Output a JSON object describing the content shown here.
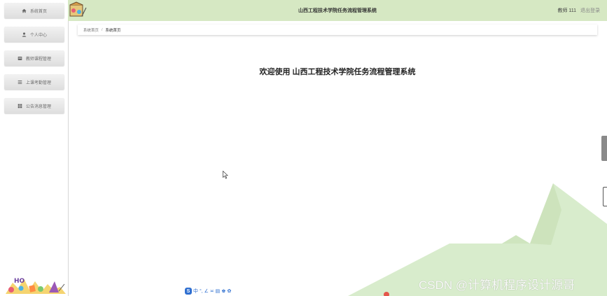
{
  "sidebar": {
    "items": [
      {
        "label": "系统首页",
        "icon": "home-icon"
      },
      {
        "label": "个人中心",
        "icon": "user-icon"
      },
      {
        "label": "教师课程管理",
        "icon": "list-icon"
      },
      {
        "label": "上课考勤管理",
        "icon": "menu-icon"
      },
      {
        "label": "公告消息管理",
        "icon": "grid-icon"
      }
    ]
  },
  "header": {
    "title": "山西工程技术学院任务流程管理系统",
    "user_label": "教师 111",
    "logout_label": "退出登录"
  },
  "breadcrumb": {
    "root": "系统首页",
    "separator": "/",
    "current": "系统首页"
  },
  "main": {
    "welcome": "欢迎使用 山西工程技术学院任务流程管理系统"
  },
  "ime_bar": {
    "logo": "S",
    "glyphs": "中 °, ∠ ≍ ▤ ♚ ✿"
  },
  "watermark": "CSDN @计算机程序设计源哥",
  "colors": {
    "header_bg": "#d6e8c3",
    "mountain": "#d8eccc",
    "sidebar_item": "#e4e4e4"
  }
}
